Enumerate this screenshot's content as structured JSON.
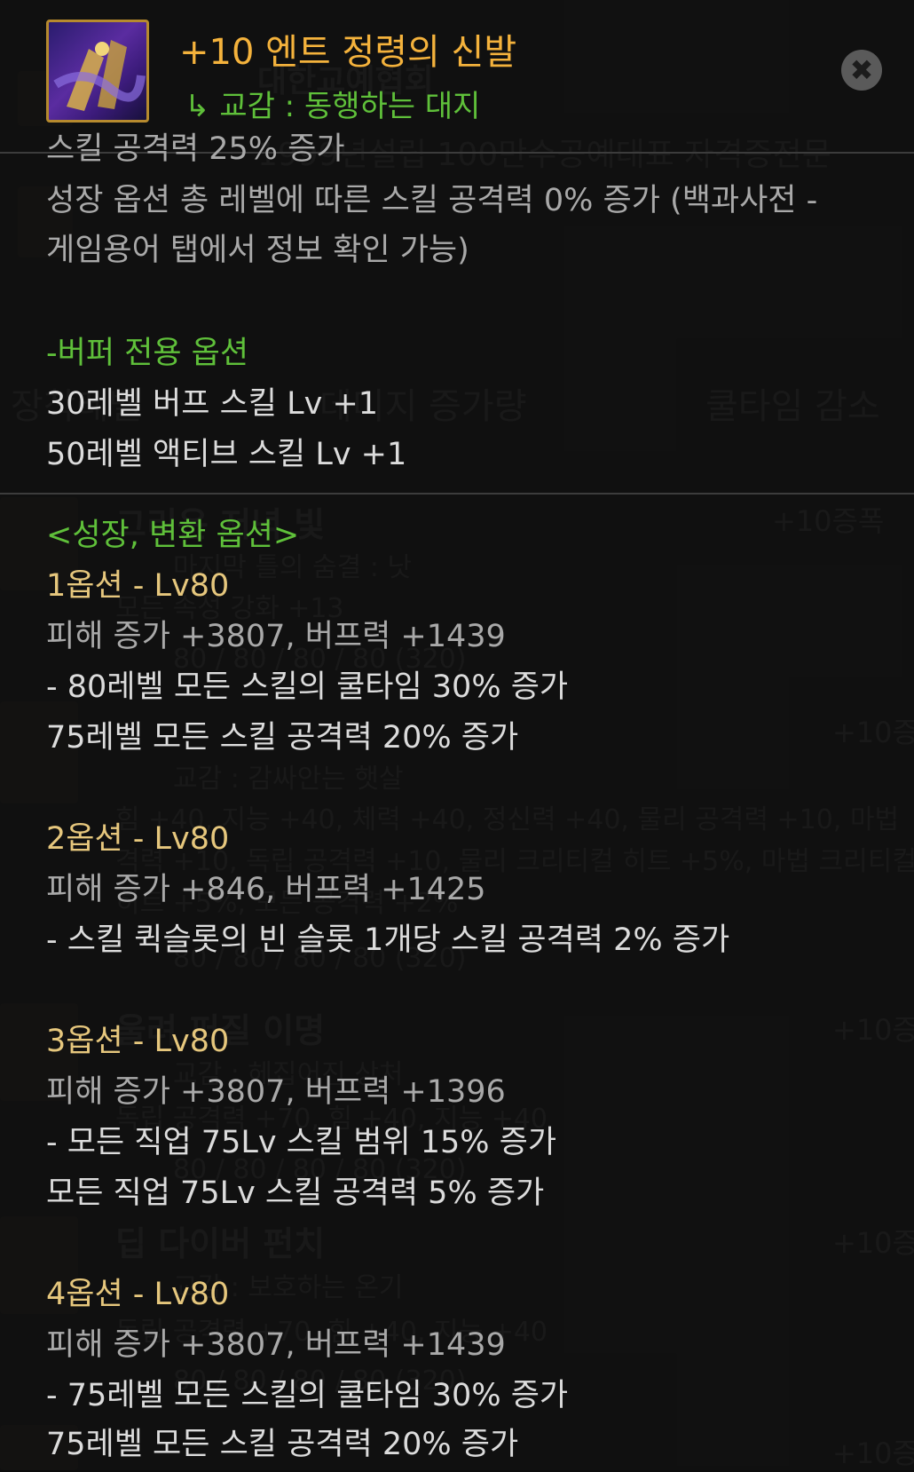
{
  "item": {
    "title": "+10 엔트 정령의 신발",
    "arrow": "↳",
    "subtitle": "교감 : 동행하는 대지"
  },
  "close_label": "✖",
  "top_option": {
    "cut_line": "스킬 공격력 25% 증가",
    "line1": "성장 옵션 총 레벨에 따른 스킬 공격력 0% 증가 (백과사전 -",
    "line2": "게임용어 탭에서 정보 확인 가능)"
  },
  "buffer": {
    "header": "-버퍼 전용 옵션",
    "lines": [
      "30레벨 버프 스킬 Lv +1",
      "50레벨 액티브 스킬 Lv +1"
    ]
  },
  "growth": {
    "header": "<성장, 변환 옵션>",
    "options": [
      {
        "title": "1옵션 - Lv80",
        "stats": "피해 증가 +3807, 버프력 +1439",
        "effects": [
          "- 80레벨 모든 스킬의 쿨타임 30% 증가",
          "75레벨 모든 스킬 공격력 20% 증가"
        ]
      },
      {
        "title": "2옵션 - Lv80",
        "stats": "피해 증가 +846, 버프력 +1425",
        "effects": [
          "- 스킬 퀵슬롯의 빈 슬롯 1개당 스킬 공격력 2% 증가"
        ]
      },
      {
        "title": "3옵션 - Lv80",
        "stats": "피해 증가 +3807, 버프력 +1396",
        "effects": [
          "- 모든 직업 75Lv 스킬 범위 15% 증가",
          "모든 직업 75Lv 스킬 공격력 5% 증가"
        ]
      },
      {
        "title": "4옵션 - Lv80",
        "stats": "피해 증가 +3807, 버프력 +1439",
        "effects": [
          "- 75레벨 모든 스킬의 쿨타임 30% 증가",
          "75레벨 모든 스킬 공격력 20% 증가"
        ]
      }
    ]
  },
  "background_page": {
    "lines": [
      "대한교예협회",
      "1999년설립 100만수공예대표 자격증전문",
      "장착레벨",
      "데미지 증가량",
      "쿨타임 감소",
      "그리운 저녁 빛",
      "+10증폭",
      "마지막 틀의 숨결 : 낫",
      "모든 속성 강화 +13",
      "80 / 80 / 80 / 80 (320)",
      "+10증",
      "교감 : 감싸안는 햇살",
      "힘 +40, 지능 +40, 체력 +40, 정신력 +40, 물리 공격력 +10, 마법",
      "격력 +10, 독립 공격력 +10, 물리 크리티컬 히트 +5%, 마법 크리티컬",
      "히트 +5%, 모든 공격력 +2%",
      "80 / 80 / 80 / 80 (320)",
      "울려 퍼질 이명",
      "+10증",
      "교감 : 헤집어진 상처",
      "독립 공격력 +70, 힘 +40, 지능 +40",
      "80 / 80 / 80 / 80 (320)",
      "딥 다이버 펀치",
      "+10증",
      "교감 : 보호하는 온기",
      "독립 공격력 +70, 힘 +40, 지능 +40",
      "80 / 80 / 80 / 80 (320)",
      "+10증"
    ]
  }
}
